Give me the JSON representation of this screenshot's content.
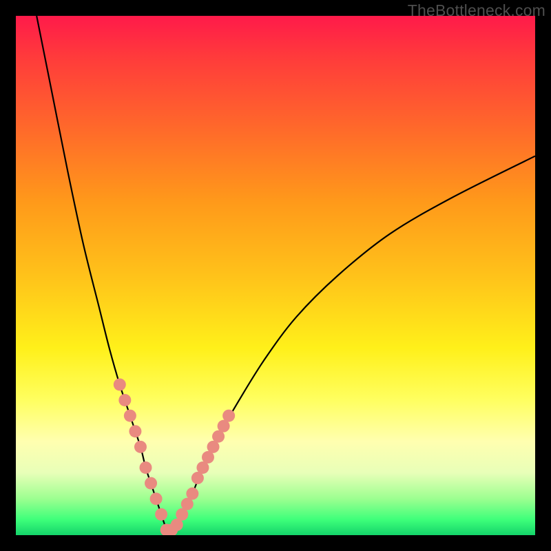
{
  "watermark": "TheBottleneck.com",
  "chart_data": {
    "type": "line",
    "title": "",
    "xlabel": "",
    "ylabel": "",
    "xlim": [
      0,
      100
    ],
    "ylim": [
      0,
      100
    ],
    "series": [
      {
        "name": "left-branch",
        "x": [
          4,
          7,
          10,
          13,
          16,
          18,
          20,
          22,
          24,
          25,
          26,
          27,
          28,
          29
        ],
        "y": [
          100,
          85,
          70,
          56,
          44,
          36,
          29,
          23,
          17,
          13,
          10,
          7,
          4,
          1
        ]
      },
      {
        "name": "right-branch",
        "x": [
          29,
          30,
          31,
          32,
          34,
          36,
          39,
          43,
          48,
          54,
          62,
          72,
          84,
          100
        ],
        "y": [
          1,
          1,
          2,
          4,
          8,
          13,
          19,
          26,
          34,
          42,
          50,
          58,
          65,
          73
        ]
      }
    ],
    "highlight_segments": {
      "comment": "salmon-colored overlay dots along the curve near the valley",
      "color": "#e98a80",
      "points": [
        {
          "x": 20,
          "y": 29
        },
        {
          "x": 21,
          "y": 26
        },
        {
          "x": 22,
          "y": 23
        },
        {
          "x": 23,
          "y": 20
        },
        {
          "x": 24,
          "y": 17
        },
        {
          "x": 25,
          "y": 13
        },
        {
          "x": 26,
          "y": 10
        },
        {
          "x": 27,
          "y": 7
        },
        {
          "x": 28,
          "y": 4
        },
        {
          "x": 29,
          "y": 1
        },
        {
          "x": 30,
          "y": 1
        },
        {
          "x": 31,
          "y": 2
        },
        {
          "x": 32,
          "y": 4
        },
        {
          "x": 33,
          "y": 6
        },
        {
          "x": 34,
          "y": 8
        },
        {
          "x": 35,
          "y": 11
        },
        {
          "x": 36,
          "y": 13
        },
        {
          "x": 37,
          "y": 15
        },
        {
          "x": 38,
          "y": 17
        },
        {
          "x": 39,
          "y": 19
        },
        {
          "x": 40,
          "y": 21
        },
        {
          "x": 41,
          "y": 23
        }
      ]
    }
  }
}
